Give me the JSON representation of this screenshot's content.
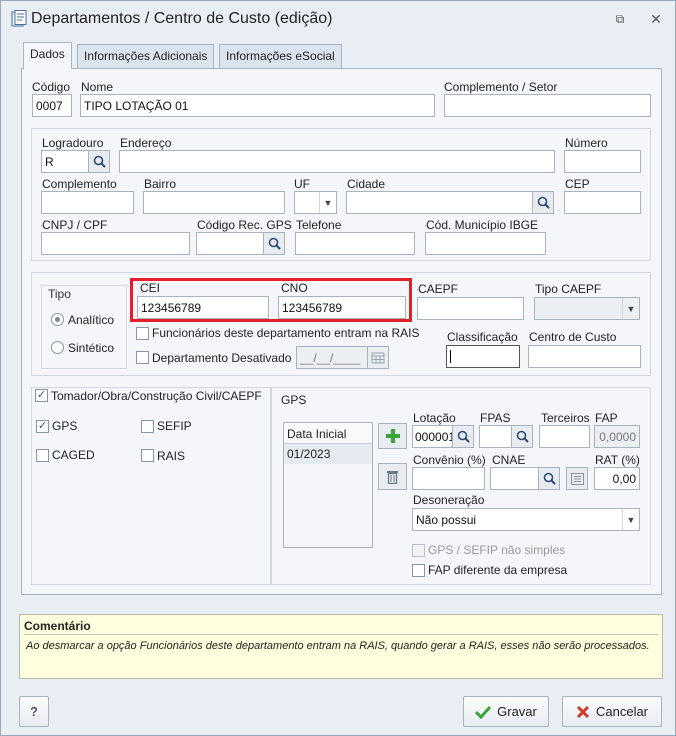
{
  "window": {
    "title": "Departamentos / Centro de Custo (edição)"
  },
  "tabs": [
    "Dados",
    "Informações Adicionais",
    "Informações eSocial"
  ],
  "header": {
    "codigo_label": "Código",
    "codigo_value": "0007",
    "nome_label": "Nome",
    "nome_value": "TIPO LOTAÇÃO 01",
    "complemento_setor_label": "Complemento / Setor",
    "complemento_setor_value": ""
  },
  "address": {
    "logradouro_label": "Logradouro",
    "logradouro_value": "R",
    "endereco_label": "Endereço",
    "numero_label": "Número",
    "complemento_label": "Complemento",
    "bairro_label": "Bairro",
    "uf_label": "UF",
    "cidade_label": "Cidade",
    "cep_label": "CEP",
    "cnpj_label": "CNPJ / CPF",
    "codigo_rec_gps_label": "Código Rec. GPS",
    "telefone_label": "Telefone",
    "cod_municipio_label": "Cód. Município IBGE"
  },
  "tipo": {
    "label": "Tipo",
    "analitico": "Analítico",
    "sintetico": "Sintético"
  },
  "cei": {
    "label": "CEI",
    "value": "123456789"
  },
  "cno": {
    "label": "CNO",
    "value": "123456789"
  },
  "caepf": {
    "label": "CAEPF",
    "tipo_label": "Tipo CAEPF"
  },
  "flags": {
    "funcionarios_rais": "Funcionários deste departamento entram na RAIS",
    "desativado": "Departamento Desativado",
    "date_placeholder": "__/__/____"
  },
  "classificacao_label": "Classificação",
  "centro_custo_label": "Centro de Custo",
  "tomador": {
    "label": "Tomador/Obra/Construção Civil/CAEPF",
    "gps": "GPS",
    "sefip": "SEFIP",
    "caged": "CAGED",
    "rais": "RAIS"
  },
  "gps": {
    "group_label": "GPS",
    "list_header": "Data Inicial",
    "list_rows": [
      "01/2023"
    ],
    "lotacao_label": "Lotação",
    "lotacao_value": "000001",
    "fpas_label": "FPAS",
    "terceiros_label": "Terceiros",
    "fap_label": "FAP",
    "fap_value": "0,0000",
    "convenio_label": "Convênio (%)",
    "cnae_label": "CNAE",
    "rat_label": "RAT (%)",
    "rat_value": "0,00",
    "desoneracao_label": "Desoneração",
    "desoneracao_value": "Não possui",
    "gps_sefip_nao_simples": "GPS / SEFIP não simples",
    "fap_diferente": "FAP diferente da empresa"
  },
  "comment": {
    "title": "Comentário",
    "text": "Ao desmarcar a opção Funcionários deste departamento entram na RAIS, quando gerar a RAIS, esses não serão processados."
  },
  "footer": {
    "help": "?",
    "save": "Gravar",
    "cancel": "Cancelar"
  },
  "colors": {
    "highlight": "#e0202a",
    "comment_bg": "#ffffdf",
    "add_green": "#3aa63a"
  }
}
